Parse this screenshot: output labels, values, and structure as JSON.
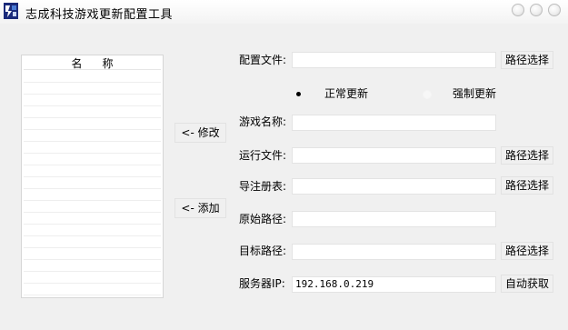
{
  "window": {
    "title": "志成科技游戏更新配置工具"
  },
  "list": {
    "column_header": "名称"
  },
  "side_buttons": {
    "modify": "<- 修改",
    "add": "<- 添加"
  },
  "config": {
    "config_file_label": "配置文件:",
    "config_file_value": "",
    "browse_label": "路径选择"
  },
  "update_mode": {
    "normal_label": "正常更新",
    "forced_label": "强制更新",
    "selected": "normal"
  },
  "form": {
    "game_name_label": "游戏名称:",
    "game_name_value": "",
    "run_file_label": "运行文件:",
    "run_file_value": "",
    "registry_label": "导注册表:",
    "registry_value": "",
    "source_path_label": "原始路径:",
    "source_path_value": "",
    "target_path_label": "目标路径:",
    "target_path_value": "",
    "server_ip_label": "服务器IP:",
    "server_ip_value": "192.168.0.219",
    "browse_label": "路径选择",
    "auto_get_label": "自动获取"
  }
}
